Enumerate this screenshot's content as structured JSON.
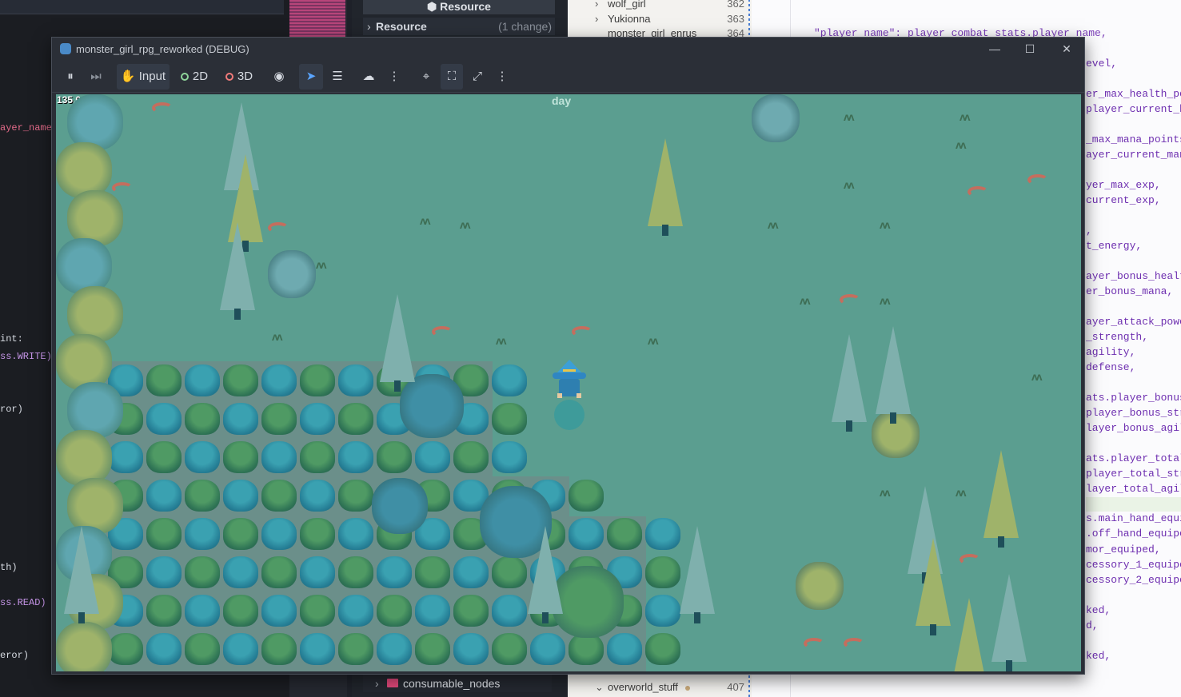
{
  "background": {
    "left_code": [
      "ayer_name",
      "int:",
      "ss.WRITE)",
      "ror)",
      "th)",
      "ss.READ)",
      "eror)"
    ],
    "resource_panel": {
      "header": "Resource",
      "row_label": "Resource",
      "row_change": "(1 change)"
    },
    "file_browser_item": "consumable_nodes",
    "scene_tree": [
      {
        "name": "wolf_girl",
        "line": "362"
      },
      {
        "name": "Yukionna",
        "line": "363"
      },
      {
        "name": "monster_girl_enrus",
        "line": "364"
      },
      {
        "name": "overworld_stuff",
        "line": "407"
      }
    ],
    "right_code_top": "\"player_name\": player_combat_stats.player_name,",
    "right_code_lines": [
      "evel,",
      "er_max_health_po",
      "player_current_h",
      "_max_mana_points",
      "ayer_current_man",
      "yer_max_exp,",
      "current_exp,",
      ",",
      "t_energy,",
      "ayer_bonus_healt",
      "er_bonus_mana,",
      "ayer_attack_powe",
      "_strength,",
      "agility,",
      "defense,",
      "ats.player_bonus",
      "player_bonus_str",
      "layer_bonus_agil",
      "ats.player_total",
      "player_total_str",
      "layer_total_agil",
      "s.main_hand_equi",
      ".off_hand_equipe",
      "mor_equiped,",
      "cessory_1_equipe",
      "cessory_2_equipe",
      "ked,",
      "d,",
      "ked,"
    ]
  },
  "window": {
    "title": "monster_girl_rpg_reworked (DEBUG)",
    "controls": {
      "minimize": "—",
      "maximize": "☐",
      "close": "✕"
    }
  },
  "toolbar": {
    "pause_icon": "⏸",
    "step_icon": "⏭",
    "input_label": "Input",
    "mode_2d_label": "2D",
    "mode_3d_label": "3D",
    "visibility_icon": "◉",
    "select_icon": "➤",
    "list_select_icon": "☰",
    "camera_icon": "☁",
    "more_icon": "⋮",
    "camera_override_icon": "⌖",
    "fit_icon": "⛶",
    "fullscreen_icon": "⤢",
    "more2_icon": "⋮",
    "resolution": "1280x720"
  },
  "game": {
    "fps": "135.0",
    "time_of_day": "day"
  },
  "colors": {
    "grass": "#5b9e90",
    "bush_green": "#4f9a64",
    "bush_teal": "#3aa1b1",
    "pine_light": "#9fb36a",
    "pine_teal": "#7fb0ad",
    "player_hat": "#3c9fd6",
    "petal": "#c46e5e",
    "accent_blue": "#5aa5ff"
  }
}
